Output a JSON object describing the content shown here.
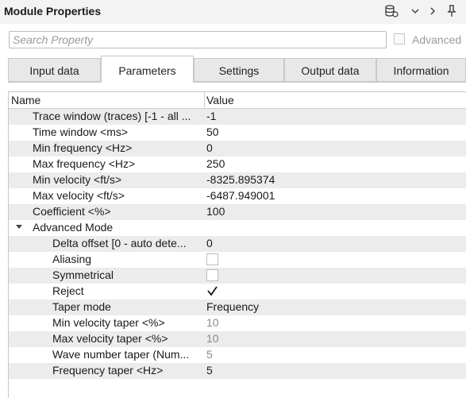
{
  "header": {
    "title": "Module Properties",
    "icons": [
      "database-settings-icon",
      "chevron-down-icon",
      "chevron-right-icon",
      "pin-icon"
    ]
  },
  "search": {
    "placeholder": "Search Property",
    "value": ""
  },
  "advanced": {
    "label": "Advanced",
    "checked": false
  },
  "tabs": [
    {
      "label": "Input data",
      "active": false
    },
    {
      "label": "Parameters",
      "active": true
    },
    {
      "label": "Settings",
      "active": false
    },
    {
      "label": "Output data",
      "active": false
    },
    {
      "label": "Information",
      "active": false
    }
  ],
  "table": {
    "columns": [
      "Name",
      "Value"
    ],
    "rows": [
      {
        "name": "Trace window (traces) [-1 - all ...",
        "value": "-1"
      },
      {
        "name": "Time window <ms>",
        "value": "50"
      },
      {
        "name": "Min frequency <Hz>",
        "value": "0"
      },
      {
        "name": "Max frequency <Hz>",
        "value": "250"
      },
      {
        "name": "Min velocity <ft/s>",
        "value": "-8325.895374"
      },
      {
        "name": "Max velocity <ft/s>",
        "value": "-6487.949001"
      },
      {
        "name": "Coefficient <%>",
        "value": "100"
      }
    ],
    "group": {
      "label": "Advanced Mode",
      "expanded": true,
      "rows": [
        {
          "name": "Delta offset [0 - auto dete...",
          "value": "0"
        },
        {
          "name": "Aliasing",
          "type": "checkbox",
          "checked": false
        },
        {
          "name": "Symmetrical",
          "type": "checkbox",
          "checked": false
        },
        {
          "name": "Reject",
          "type": "checkbox",
          "checked": true
        },
        {
          "name": "Taper mode",
          "value": "Frequency"
        },
        {
          "name": "Min velocity taper <%>",
          "value": "10",
          "disabled": true
        },
        {
          "name": "Max velocity taper <%>",
          "value": "10",
          "disabled": true
        },
        {
          "name": "Wave number taper (Num...",
          "value": "5",
          "disabled": true
        },
        {
          "name": "Frequency taper <Hz>",
          "value": "5"
        }
      ]
    }
  }
}
